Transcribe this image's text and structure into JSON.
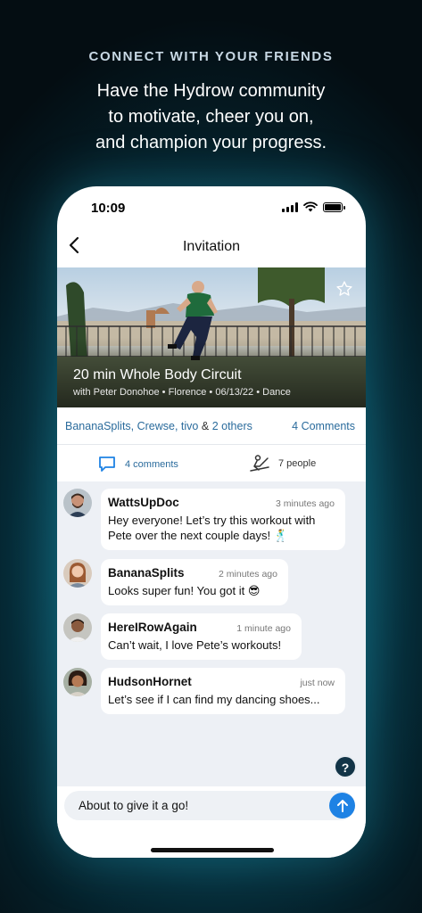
{
  "promo": {
    "tagline": "CONNECT WITH YOUR FRIENDS",
    "headline_lines": [
      "Have the Hydrow community",
      "to motivate, cheer you on,",
      "and champion your progress."
    ]
  },
  "status_bar": {
    "time": "10:09"
  },
  "nav": {
    "title": "Invitation",
    "back_icon": "chevron-left-icon"
  },
  "workout": {
    "title": "20 min Whole Body Circuit",
    "subtitle": "with Peter Donohoe • Florence • 06/13/22 • Dance",
    "favorite_icon": "star-outline-icon"
  },
  "invitation": {
    "names": "BananaSplits, Crewse, tivo",
    "amp": "&",
    "others": "2 others",
    "comments_link": "4 Comments"
  },
  "stats": {
    "comments_label": "4 comments",
    "people_label": "7 people"
  },
  "messages": [
    {
      "user": "WattsUpDoc",
      "time": "3 minutes ago",
      "text_line1": "Hey everyone! Let’s try this workout with",
      "text_line2": "Pete over the next couple days! 🕺"
    },
    {
      "user": "BananaSplits",
      "time": "2 minutes ago",
      "text_line1": "Looks super fun! You got it 😎"
    },
    {
      "user": "HereIRowAgain",
      "time": "1 minute ago",
      "text_line1": "Can’t wait, I love Pete’s workouts!"
    },
    {
      "user": "HudsonHornet",
      "time": "just now",
      "text_line1": "Let’s see if I can find my dancing shoes..."
    }
  ],
  "composer": {
    "value": "About to give it a go!",
    "send_icon": "arrow-up-icon"
  },
  "help_icon": "question-icon"
}
